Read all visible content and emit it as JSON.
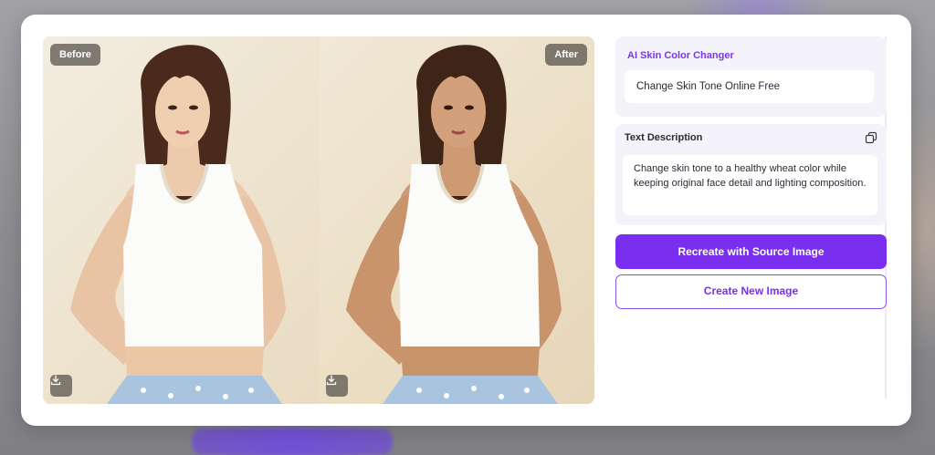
{
  "comparison": {
    "before_label": "Before",
    "after_label": "After"
  },
  "panel": {
    "model_title": "AI Skin Color Changer",
    "model_name": "Change Skin Tone Online Free",
    "description_title": "Text Description",
    "description_text": "Change skin tone to a healthy wheat color while keeping original face detail and lighting composition.",
    "recreate_label": "Recreate with Source Image",
    "create_new_label": "Create New Image"
  },
  "colors": {
    "accent": "#7a2ff0",
    "model_title": "#7a37e6",
    "card_bg": "#f4f3fa"
  },
  "icons": {
    "download": "download-icon",
    "copy": "copy-icon"
  }
}
